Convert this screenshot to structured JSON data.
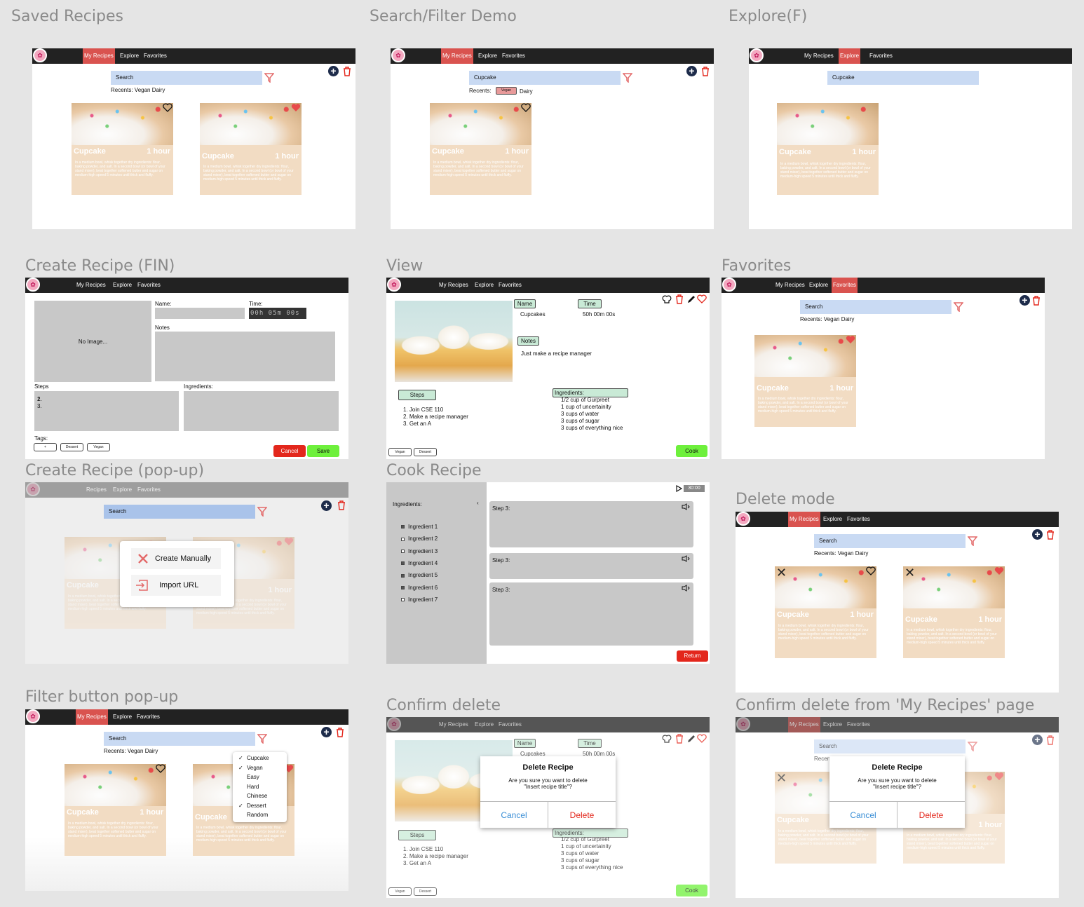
{
  "titles": {
    "saved": "Saved Recipes",
    "search_demo": "Search/Filter Demo",
    "explore": "Explore(F)",
    "create_fin": "Create Recipe (FIN)",
    "view": "View",
    "favorites": "Favorites",
    "create_popup": "Create Recipe (pop-up)",
    "cook": "Cook Recipe",
    "delete_mode": "Delete mode",
    "filter_popup": "Filter button pop-up",
    "confirm_delete": "Confirm delete",
    "confirm_delete_my": "Confirm delete from 'My Recipes' page"
  },
  "nav": {
    "my_recipes": "My Recipes",
    "recipes": "Recipes",
    "explore": "Explore",
    "favorites": "Favorites"
  },
  "search": {
    "placeholder": "Search",
    "cupcake": "Cupcake"
  },
  "recents": {
    "full": "Recents:  Vegan  Dairy",
    "label": "Recents:",
    "vegan": "Vegan",
    "dairy": "Dairy"
  },
  "card": {
    "name": "Cupcake",
    "time": "1 hour",
    "desc": "In a medium bowl, whisk together dry ingredients: flour, baking powder, and salt. In a second bowl (or bowl of your stand mixer), beat together softened butter and sugar on medium-high speed 5 minutes until thick and fluffy."
  },
  "create": {
    "no_image": "No Image...",
    "name": "Name:",
    "time": "Time:",
    "time_value": "00h 05m 00s",
    "notes": "Notes",
    "steps": "Steps",
    "steps_list": [
      "1.",
      "2.",
      "3."
    ],
    "ingredients": "Ingredients:",
    "tags": "Tags:",
    "tag_add": "+",
    "tag_dessert": "Dessert",
    "tag_vegan": "Vegan",
    "cancel": "Cancel",
    "save": "Save"
  },
  "view": {
    "name_label": "Name",
    "name_value": "Cupcakes",
    "time_label": "Time",
    "time_value": "50h 00m 00s",
    "notes_label": "Notes",
    "notes_value": "Just make a recipe manager",
    "steps_label": "Steps",
    "steps": [
      "1. Join CSE 110",
      "2. Make a recipe manager",
      "3. Get an A"
    ],
    "ingredients_label": "Ingredients:",
    "ingredients": [
      "1/2 cup of Gurpreet",
      "1 cup of uncertainity",
      "3 cups of water",
      "3 cups of sugar",
      "3 cups of everything nice"
    ],
    "tag_vegan": "Vegan",
    "tag_dessert": "Dessert",
    "cook": "Cook"
  },
  "popup": {
    "create_manually": "Create Manually",
    "import_url": "Import URL"
  },
  "cook": {
    "ingredients_label": "Ingredients:",
    "ingredients": [
      "Ingredient 1",
      "Ingredient 2",
      "Ingredient 3",
      "Ingredient 4",
      "Ingredient 5",
      "Ingredient 6",
      "Ingredient 7"
    ],
    "checked": [
      true,
      false,
      false,
      true,
      true,
      true,
      false
    ],
    "timer": "30:00",
    "step_label": "Step 3:",
    "return": "Return"
  },
  "filter_menu": {
    "options": [
      "Cupcake",
      "Vegan",
      "Easy",
      "Hard",
      "Chinese",
      "Dessert",
      "Random"
    ],
    "checked": [
      true,
      true,
      false,
      false,
      false,
      true,
      false
    ]
  },
  "dialog": {
    "title": "Delete Recipe",
    "text": "Are you sure you want to delete \"Insert recipe title\"?",
    "cancel": "Cancel",
    "delete": "Delete"
  },
  "colors": {
    "nav": "#222222",
    "active_nav": "#d9534f",
    "search": "#c9daf3",
    "card": "#f2dcc3",
    "cancel": "#e3271c",
    "save": "#6ef03c",
    "dialog_cancel": "#3b8fd6",
    "dialog_delete": "#e3271c"
  }
}
